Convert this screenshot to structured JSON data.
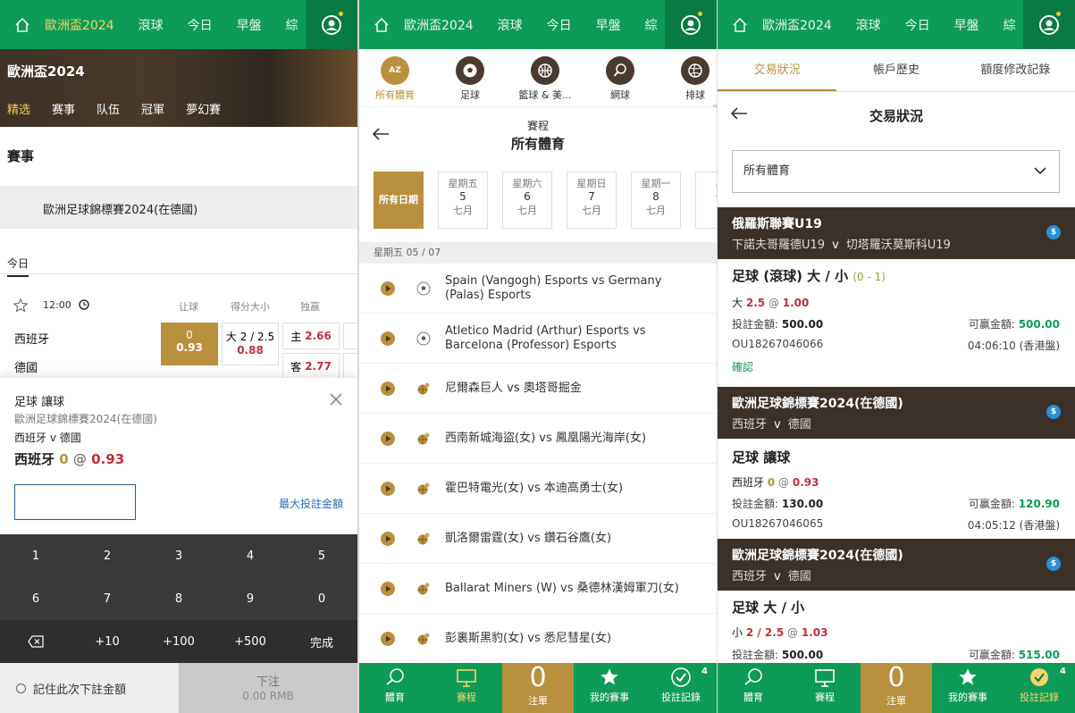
{
  "topnav": {
    "p1": [
      "歐洲盃2024",
      "滾球",
      "今日",
      "早盤",
      "綜"
    ],
    "p2": [
      "歐洲盃2024",
      "滾球",
      "今日",
      "早盤",
      "綜"
    ],
    "p3": [
      "歐洲盃2024",
      "滾球",
      "今日",
      "早盤",
      "綜"
    ]
  },
  "panel1": {
    "hero_title": "歐洲盃2024",
    "tabs": [
      "精选",
      "赛事",
      "队伍",
      "冠軍",
      "夢幻賽"
    ],
    "section_title": "賽事",
    "league": "歐洲足球錦標賽2024(在德國)",
    "today_tab": "今日",
    "match": {
      "time": "12:00",
      "col_handicap": "让球",
      "col_ou": "得分大小",
      "col_1x2": "独赢",
      "team_home": "西班牙",
      "team_away": "德國",
      "hdp_line": "0",
      "hdp_odds": "0.93",
      "ou_line": "大 2 / 2.5",
      "ou_odds": "0.88",
      "home_label": "主",
      "home_odds": "2.66",
      "away_label": "客",
      "away_odds": "2.77"
    },
    "slip": {
      "market": "足球 讓球",
      "league": "歐洲足球錦標賽2024(在德國)",
      "teams": "西班牙 v 德國",
      "pick_team": "西班牙",
      "pick_line": "0",
      "pick_at": "@",
      "pick_odds": "0.93",
      "stake_value": "",
      "max_stake": "最大投註金額",
      "keys_row1": [
        "1",
        "2",
        "3",
        "4",
        "5"
      ],
      "keys_row2": [
        "6",
        "7",
        "8",
        "9",
        "0"
      ],
      "keys_row3": [
        "+10",
        "+100",
        "+500",
        "完成"
      ],
      "remember": "記住此次下註金額",
      "place_label": "下注",
      "place_sub": "0.00 RMB"
    }
  },
  "panel2": {
    "sports": [
      "所有體育",
      "足球",
      "籃球 & 美...",
      "網球",
      "排球"
    ],
    "az_label": "AZ",
    "header_small": "賽程",
    "header_big": "所有體育",
    "date_all": "所有日期",
    "dates": [
      {
        "day": "星期五",
        "num": "5",
        "month": "七月"
      },
      {
        "day": "星期六",
        "num": "6",
        "month": "七月"
      },
      {
        "day": "星期日",
        "num": "7",
        "month": "七月"
      },
      {
        "day": "星期一",
        "num": "8",
        "month": "七月"
      },
      {
        "day": "星",
        "num": "",
        "month": "十"
      }
    ],
    "day_bar": "星期五 05 / 07",
    "events": [
      "Spain (Vangogh) Esports vs Germany (Palas) Esports",
      "Atletico Madrid (Arthur) Esports vs Barcelona (Professor) Esports",
      "尼爾森巨人 vs 奧塔哥掘金",
      "西南新城海盜(女) vs 鳳凰陽光海岸(女)",
      "霍巴特電光(女) vs 本迪高勇士(女)",
      "凱洛爾雷霆(女) vs 鑽石谷鷹(女)",
      "Ballarat Miners (W) vs 桑德林漢姆軍刀(女)",
      "彭裏斯黑豹(女) vs 悉尼彗星(女)"
    ]
  },
  "bottomnav": {
    "items": [
      "體育",
      "賽程",
      "注單",
      "我的賽事",
      "投註記錄"
    ],
    "slip_count": "0",
    "records_badge": "4"
  },
  "panel3": {
    "tabs": [
      "交易狀況",
      "帳戶歷史",
      "額度修改記錄"
    ],
    "title": "交易狀況",
    "filter": "所有體育",
    "coin": "$",
    "bets": [
      {
        "league": "俄羅斯聯賽U19",
        "home": "下諾夫哥羅德U19",
        "v": "v",
        "away": "切塔羅沃莫斯科U19",
        "market": "足球 (滾球) 大 / 小",
        "score": "(0 - 1)",
        "pick_side": "大",
        "pick_line": "2.5",
        "pick_at": "@",
        "pick_odds": "1.00",
        "stake_label": "投註金額:",
        "stake": "500.00",
        "win_label": "可赢金額:",
        "win": "500.00",
        "ref": "OU18267046066",
        "time": "04:06:10 (香港盤)",
        "status": "確認"
      },
      {
        "league": "歐洲足球錦標賽2024(在德國)",
        "home": "西班牙",
        "v": "v",
        "away": "德國",
        "market": "足球 讓球",
        "pick_side": "西班牙",
        "pick_line": "0",
        "pick_at": "@",
        "pick_odds": "0.93",
        "stake_label": "投註金額:",
        "stake": "130.00",
        "win_label": "可赢金額:",
        "win": "120.90",
        "ref": "OU18267046065",
        "time": "04:05:12 (香港盤)"
      },
      {
        "league": "歐洲足球錦標賽2024(在德國)",
        "home": "西班牙",
        "v": "v",
        "away": "德國",
        "market": "足球 大 / 小",
        "pick_side": "小",
        "pick_line": "2 / 2.5",
        "pick_at": "@",
        "pick_odds": "1.03",
        "stake_label": "投註金額:",
        "stake": "500.00",
        "win_label": "可赢金額:",
        "win": "515.00"
      }
    ]
  },
  "colors": {
    "green": "#0e9b57",
    "gold": "#b9903d",
    "dark_brown": "#3c3129",
    "red": "#c0303a"
  }
}
